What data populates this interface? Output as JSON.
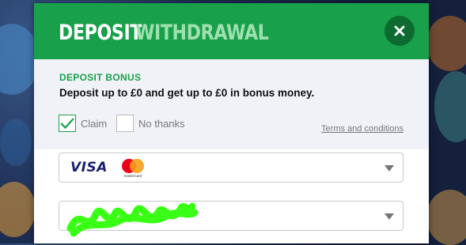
{
  "tabs": {
    "deposit_label": "DEPOSIT",
    "withdrawal_label": "WITHDRAWAL"
  },
  "close_icon": "close-icon",
  "bonus": {
    "title": "DEPOSIT BONUS",
    "text": "Deposit up to £0 and get up to £0 in bonus money.",
    "options": [
      {
        "label": "Claim",
        "checked": true
      },
      {
        "label": "No thanks",
        "checked": false
      }
    ],
    "terms_label": "Terms and conditions"
  },
  "payment_method": {
    "brand_text": "VISA",
    "mastercard_text": "mastercard",
    "icon": "chevron-down-icon"
  },
  "account_select": {
    "value_redacted": true,
    "icon": "chevron-down-icon"
  },
  "colors": {
    "brand_green": "#18a04b",
    "close_button": "#0d6b31",
    "withdrawal_inactive": "#9fe0b0",
    "bonus_background": "#f1f2f8",
    "redaction": "#39ff14"
  }
}
